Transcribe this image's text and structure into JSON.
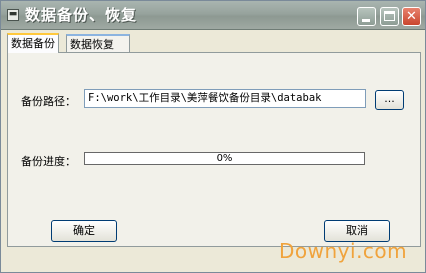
{
  "window": {
    "title": "数据备份、恢复",
    "sysmenu_icon": "window-menu-icon",
    "controls": {
      "minimize_icon": "minimize-icon",
      "maximize_icon": "maximize-icon",
      "close_glyph": "✕"
    }
  },
  "tabs": [
    {
      "label": "数据备份",
      "active": true
    },
    {
      "label": "数据恢复",
      "active": false
    }
  ],
  "form": {
    "path_label": "备份路径：",
    "path_value": "F:\\work\\工作目录\\美萍餐饮备份目录\\databak",
    "browse_label": "...",
    "progress_label": "备份进度：",
    "progress_value": 0,
    "progress_text": "0%"
  },
  "buttons": {
    "ok": "确定",
    "cancel": "取消"
  },
  "watermark": "Downyi.com",
  "colors": {
    "titlebar": "#97a39d",
    "window_bg": "#ece9d8",
    "watermark": "#f0a33c",
    "active_tab_accent": "#ffc83c"
  }
}
